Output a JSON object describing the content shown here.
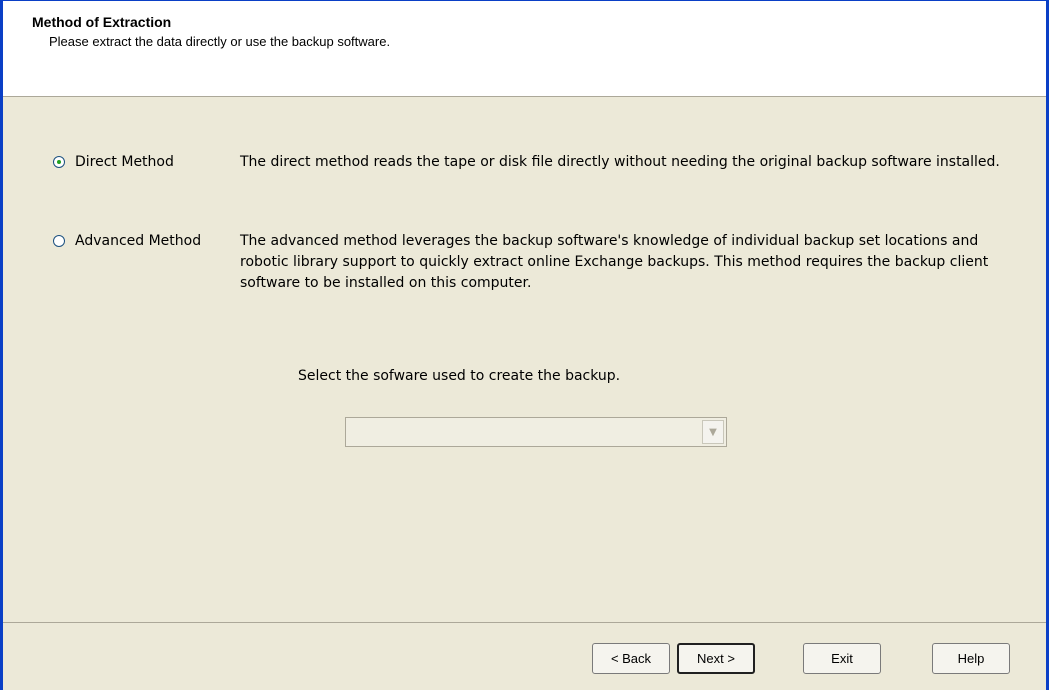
{
  "header": {
    "title": "Method of Extraction",
    "subtitle": "Please extract the data directly or use the backup software."
  },
  "options": [
    {
      "label": "Direct Method",
      "selected": true,
      "description": "The direct method reads the tape or disk file directly without needing the original backup software installed."
    },
    {
      "label": "Advanced Method",
      "selected": false,
      "description": "The advanced method leverages the backup software's knowledge of individual backup set locations and robotic library support to quickly extract online Exchange backups.  This method requires the backup client software to be installed on this computer."
    }
  ],
  "software_select": {
    "prompt": "Select the sofware used to create the backup.",
    "value": "",
    "dropdown_icon": "chevron-down-icon"
  },
  "buttons": {
    "back": "< Back",
    "next": "Next >",
    "exit": "Exit",
    "help": "Help"
  }
}
